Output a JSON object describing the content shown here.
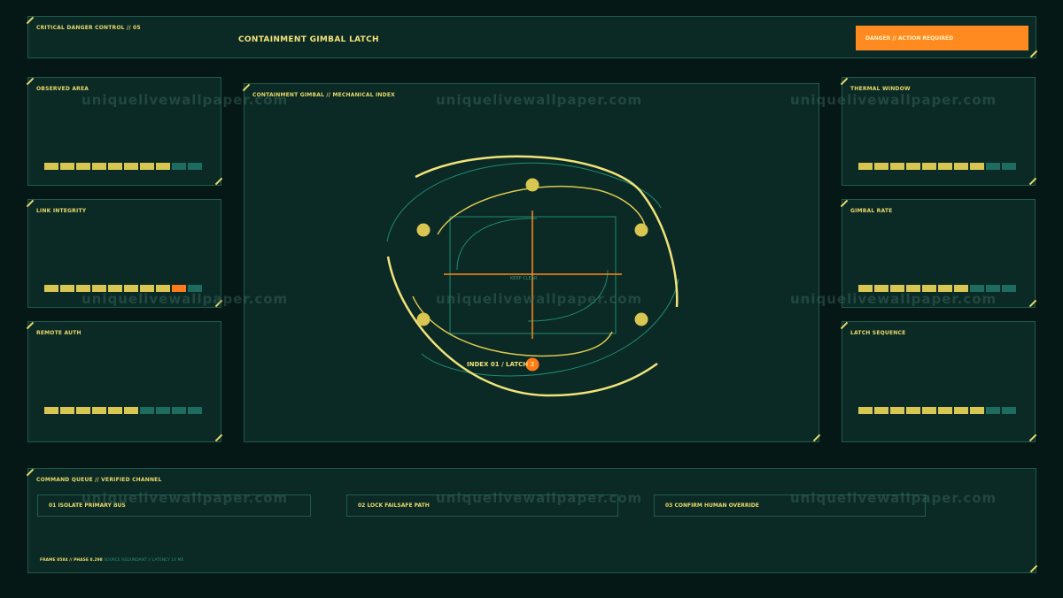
{
  "header": {
    "tag": "CRITICAL DANGER CONTROL // 05",
    "title": "CONTAINMENT GIMBAL LATCH",
    "alert": "DANGER // ACTION REQUIRED"
  },
  "left_panels": [
    {
      "title": "OBSERVED AREA",
      "bars": [
        "on",
        "on",
        "on",
        "on",
        "on",
        "on",
        "on",
        "on",
        "off",
        "off"
      ]
    },
    {
      "title": "LINK INTEGRITY",
      "bars": [
        "on",
        "on",
        "on",
        "on",
        "on",
        "on",
        "on",
        "on",
        "warn",
        "off"
      ]
    },
    {
      "title": "REMOTE AUTH",
      "bars": [
        "on",
        "on",
        "on",
        "on",
        "on",
        "on",
        "off",
        "off",
        "off",
        "off"
      ]
    }
  ],
  "right_panels": [
    {
      "title": "THERMAL WINDOW",
      "bars": [
        "on",
        "on",
        "on",
        "on",
        "on",
        "on",
        "on",
        "on",
        "off",
        "off"
      ]
    },
    {
      "title": "GIMBAL RATE",
      "bars": [
        "on",
        "on",
        "on",
        "on",
        "on",
        "on",
        "on",
        "off",
        "off",
        "off"
      ]
    },
    {
      "title": "LATCH SEQUENCE",
      "bars": [
        "on",
        "on",
        "on",
        "on",
        "on",
        "on",
        "on",
        "on",
        "off",
        "off"
      ]
    }
  ],
  "center": {
    "title": "CONTAINMENT GIMBAL // MECHANICAL INDEX",
    "keep_clear": "KEEP CLEAR",
    "index_label": "INDEX 01 / LATCH 2"
  },
  "command": {
    "title": "COMMAND QUEUE // VERIFIED CHANNEL",
    "items": [
      "01  ISOLATE PRIMARY BUS",
      "02  LOCK FAILSAFE PATH",
      "03  CONFIRM HUMAN OVERRIDE"
    ],
    "status_a": "FRAME 8584 // PHASE 8.298",
    "status_b": "SOURCE REDUNDANT // LATENCY 14 MS"
  },
  "watermark": "uniquelivewallpaper.com",
  "colors": {
    "accent": "#e8d96a",
    "warning": "#ff8a1f",
    "panel": "#0b2a25",
    "line": "#1f5a4e"
  }
}
